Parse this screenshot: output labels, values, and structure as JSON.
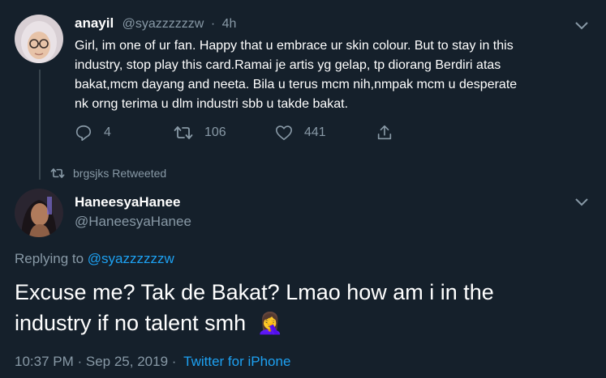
{
  "reply_tweet": {
    "display_name": "anayil",
    "handle": "@syazzzzzzw",
    "separator": "·",
    "time": "4h",
    "text_lines": [
      "Girl, im one of ur fan. Happy that u embrace ur skin colour. But to stay in this",
      "industry, stop play this card.Ramai je artis yg gelap, tp diorang Berdiri atas",
      "bakat,mcm dayang and neeta. Bila u terus mcm nih,nmpak mcm u desperate",
      "nk orng terima u dlm industri sbb u takde bakat."
    ],
    "replies": "4",
    "retweets": "106",
    "likes": "441"
  },
  "retweet_context": {
    "label": "brgsjks Retweeted"
  },
  "main_tweet": {
    "display_name": "HaneesyaHanee",
    "handle": "@HaneesyaHanee",
    "replying_prefix": "Replying to",
    "replying_to": "@syazzzzzzw",
    "text_lines": [
      "Excuse me? Tak de Bakat? Lmao how am i in the",
      "industry if no talent smh"
    ],
    "emoji": "🤦‍♀️",
    "timestamp": "10:37 PM · Sep 25, 2019 ·",
    "source": "Twitter for iPhone"
  },
  "icons": [
    "chevron-down-icon",
    "reply-icon",
    "retweet-icon",
    "like-icon",
    "share-icon",
    "retweet-small-icon",
    "facepalm-emoji"
  ],
  "colors": {
    "background": "#15202b",
    "text": "#ffffff",
    "muted": "#8899a6",
    "link": "#1da1f2",
    "divider": "#38444d"
  }
}
